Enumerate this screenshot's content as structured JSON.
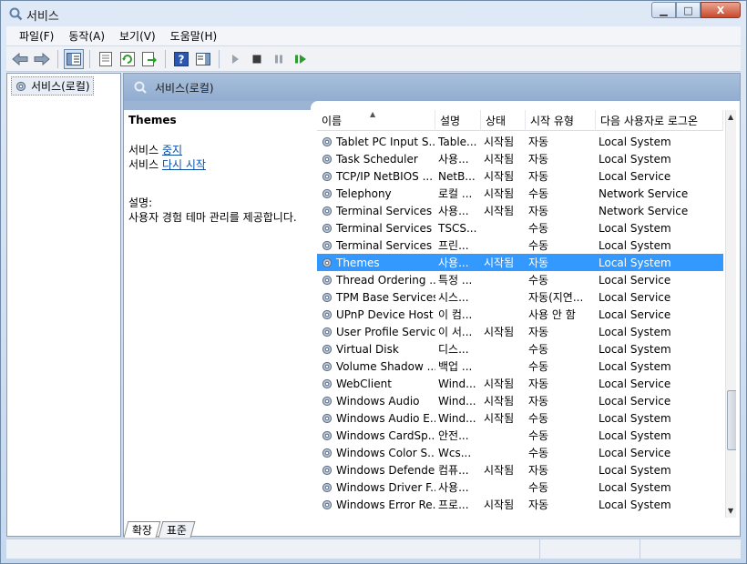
{
  "window": {
    "title": "서비스",
    "icon": "services-icon"
  },
  "caption_buttons": {
    "minimize": "▁",
    "maximize": "□",
    "close": "X"
  },
  "menu": [
    {
      "label": "파일(F)"
    },
    {
      "label": "동작(A)"
    },
    {
      "label": "보기(V)"
    },
    {
      "label": "도움말(H)"
    }
  ],
  "tree": {
    "root_label": "서비스(로컬)"
  },
  "main": {
    "header_title": "서비스(로컬)",
    "details": {
      "service_name": "Themes",
      "stop_prefix": "서비스 ",
      "stop_link": "중지",
      "restart_prefix": "서비스 ",
      "restart_link": "다시 시작",
      "description_label": "설명:",
      "description_text": "사용자 경험 테마 관리를 제공합니다."
    },
    "columns": {
      "name": "이름",
      "desc": "설명",
      "status": "상태",
      "startup": "시작 유형",
      "logon": "다음 사용자로 로그온"
    },
    "rows": [
      {
        "name": "Tablet PC Input S...",
        "desc": "Table...",
        "status": "시작됨",
        "startup": "자동",
        "logon": "Local System"
      },
      {
        "name": "Task Scheduler",
        "desc": "사용...",
        "status": "시작됨",
        "startup": "자동",
        "logon": "Local System"
      },
      {
        "name": "TCP/IP NetBIOS ...",
        "desc": "NetB...",
        "status": "시작됨",
        "startup": "자동",
        "logon": "Local Service"
      },
      {
        "name": "Telephony",
        "desc": "로컬 ...",
        "status": "시작됨",
        "startup": "수동",
        "logon": "Network Service"
      },
      {
        "name": "Terminal Services",
        "desc": "사용...",
        "status": "시작됨",
        "startup": "자동",
        "logon": "Network Service"
      },
      {
        "name": "Terminal Services ...",
        "desc": "TSCS...",
        "status": "",
        "startup": "수동",
        "logon": "Local System"
      },
      {
        "name": "Terminal Services ...",
        "desc": "프린...",
        "status": "",
        "startup": "수동",
        "logon": "Local System"
      },
      {
        "name": "Themes",
        "desc": "사용...",
        "status": "시작됨",
        "startup": "자동",
        "logon": "Local System",
        "selected": true
      },
      {
        "name": "Thread Ordering ...",
        "desc": "특정 ...",
        "status": "",
        "startup": "수동",
        "logon": "Local Service"
      },
      {
        "name": "TPM Base Services",
        "desc": "시스...",
        "status": "",
        "startup": "자동(지연...",
        "logon": "Local Service"
      },
      {
        "name": "UPnP Device Host",
        "desc": "이 컴...",
        "status": "",
        "startup": "사용 안 함",
        "logon": "Local Service"
      },
      {
        "name": "User Profile Service",
        "desc": "이 서...",
        "status": "시작됨",
        "startup": "자동",
        "logon": "Local System"
      },
      {
        "name": "Virtual Disk",
        "desc": "디스...",
        "status": "",
        "startup": "수동",
        "logon": "Local System"
      },
      {
        "name": "Volume Shadow ...",
        "desc": "백업 ...",
        "status": "",
        "startup": "수동",
        "logon": "Local System"
      },
      {
        "name": "WebClient",
        "desc": "Wind...",
        "status": "시작됨",
        "startup": "자동",
        "logon": "Local Service"
      },
      {
        "name": "Windows Audio",
        "desc": "Wind...",
        "status": "시작됨",
        "startup": "자동",
        "logon": "Local Service"
      },
      {
        "name": "Windows Audio E...",
        "desc": "Wind...",
        "status": "시작됨",
        "startup": "수동",
        "logon": "Local System"
      },
      {
        "name": "Windows CardSp...",
        "desc": "안전...",
        "status": "",
        "startup": "수동",
        "logon": "Local System"
      },
      {
        "name": "Windows Color S...",
        "desc": "Wcs...",
        "status": "",
        "startup": "수동",
        "logon": "Local Service"
      },
      {
        "name": "Windows Defender",
        "desc": "컴퓨...",
        "status": "시작됨",
        "startup": "자동",
        "logon": "Local System"
      },
      {
        "name": "Windows Driver F...",
        "desc": "사용...",
        "status": "",
        "startup": "수동",
        "logon": "Local System"
      },
      {
        "name": "Windows Error Re...",
        "desc": "프로...",
        "status": "시작됨",
        "startup": "자동",
        "logon": "Local System"
      }
    ],
    "tabs": [
      {
        "label": "확장"
      },
      {
        "label": "표준"
      }
    ]
  },
  "colors": {
    "selection": "#3399ff",
    "link": "#0a4ea8",
    "header_band": "#9bb4d3"
  }
}
